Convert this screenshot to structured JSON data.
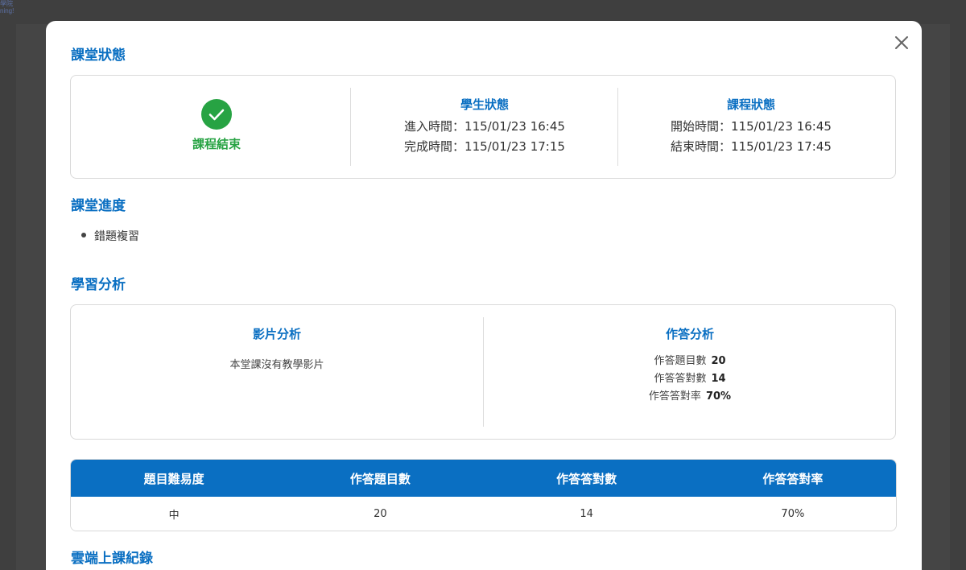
{
  "background": {
    "corner_text": [
      "學院",
      "ning!"
    ]
  },
  "modal": {
    "close_icon": "close-icon",
    "class_status": {
      "title": "課堂狀態",
      "completion": {
        "icon": "check-circle-icon",
        "label": "課程結束",
        "color": "#27a343"
      },
      "student_status": {
        "title": "學生狀態",
        "enter_time": "進入時間：115/01/23 16:45",
        "complete_time": "完成時間：115/01/23 17:15"
      },
      "course_status": {
        "title": "課程狀態",
        "start_time": "開始時間：115/01/23 16:45",
        "end_time": "結束時間：115/01/23 17:45"
      }
    },
    "class_progress": {
      "title": "課堂進度",
      "items": [
        "錯題複習"
      ]
    },
    "learning_analysis": {
      "title": "學習分析",
      "video": {
        "title": "影片分析",
        "message": "本堂課沒有教學影片"
      },
      "answers": {
        "title": "作答分析",
        "rows": [
          {
            "label": "作答題目數",
            "value": "20"
          },
          {
            "label": "作答答對數",
            "value": "14"
          },
          {
            "label": "作答答對率",
            "value": "70%"
          }
        ]
      }
    },
    "difficulty_table": {
      "headers": [
        "題目難易度",
        "作答題目數",
        "作答答對數",
        "作答答對率"
      ],
      "rows": [
        [
          "中",
          "20",
          "14",
          "70%"
        ]
      ]
    },
    "cloud_records": {
      "title": "雲端上課紀錄"
    }
  },
  "colors": {
    "accent": "#0a6fc2",
    "success": "#27a343",
    "overlay": "#3f3f3f"
  }
}
